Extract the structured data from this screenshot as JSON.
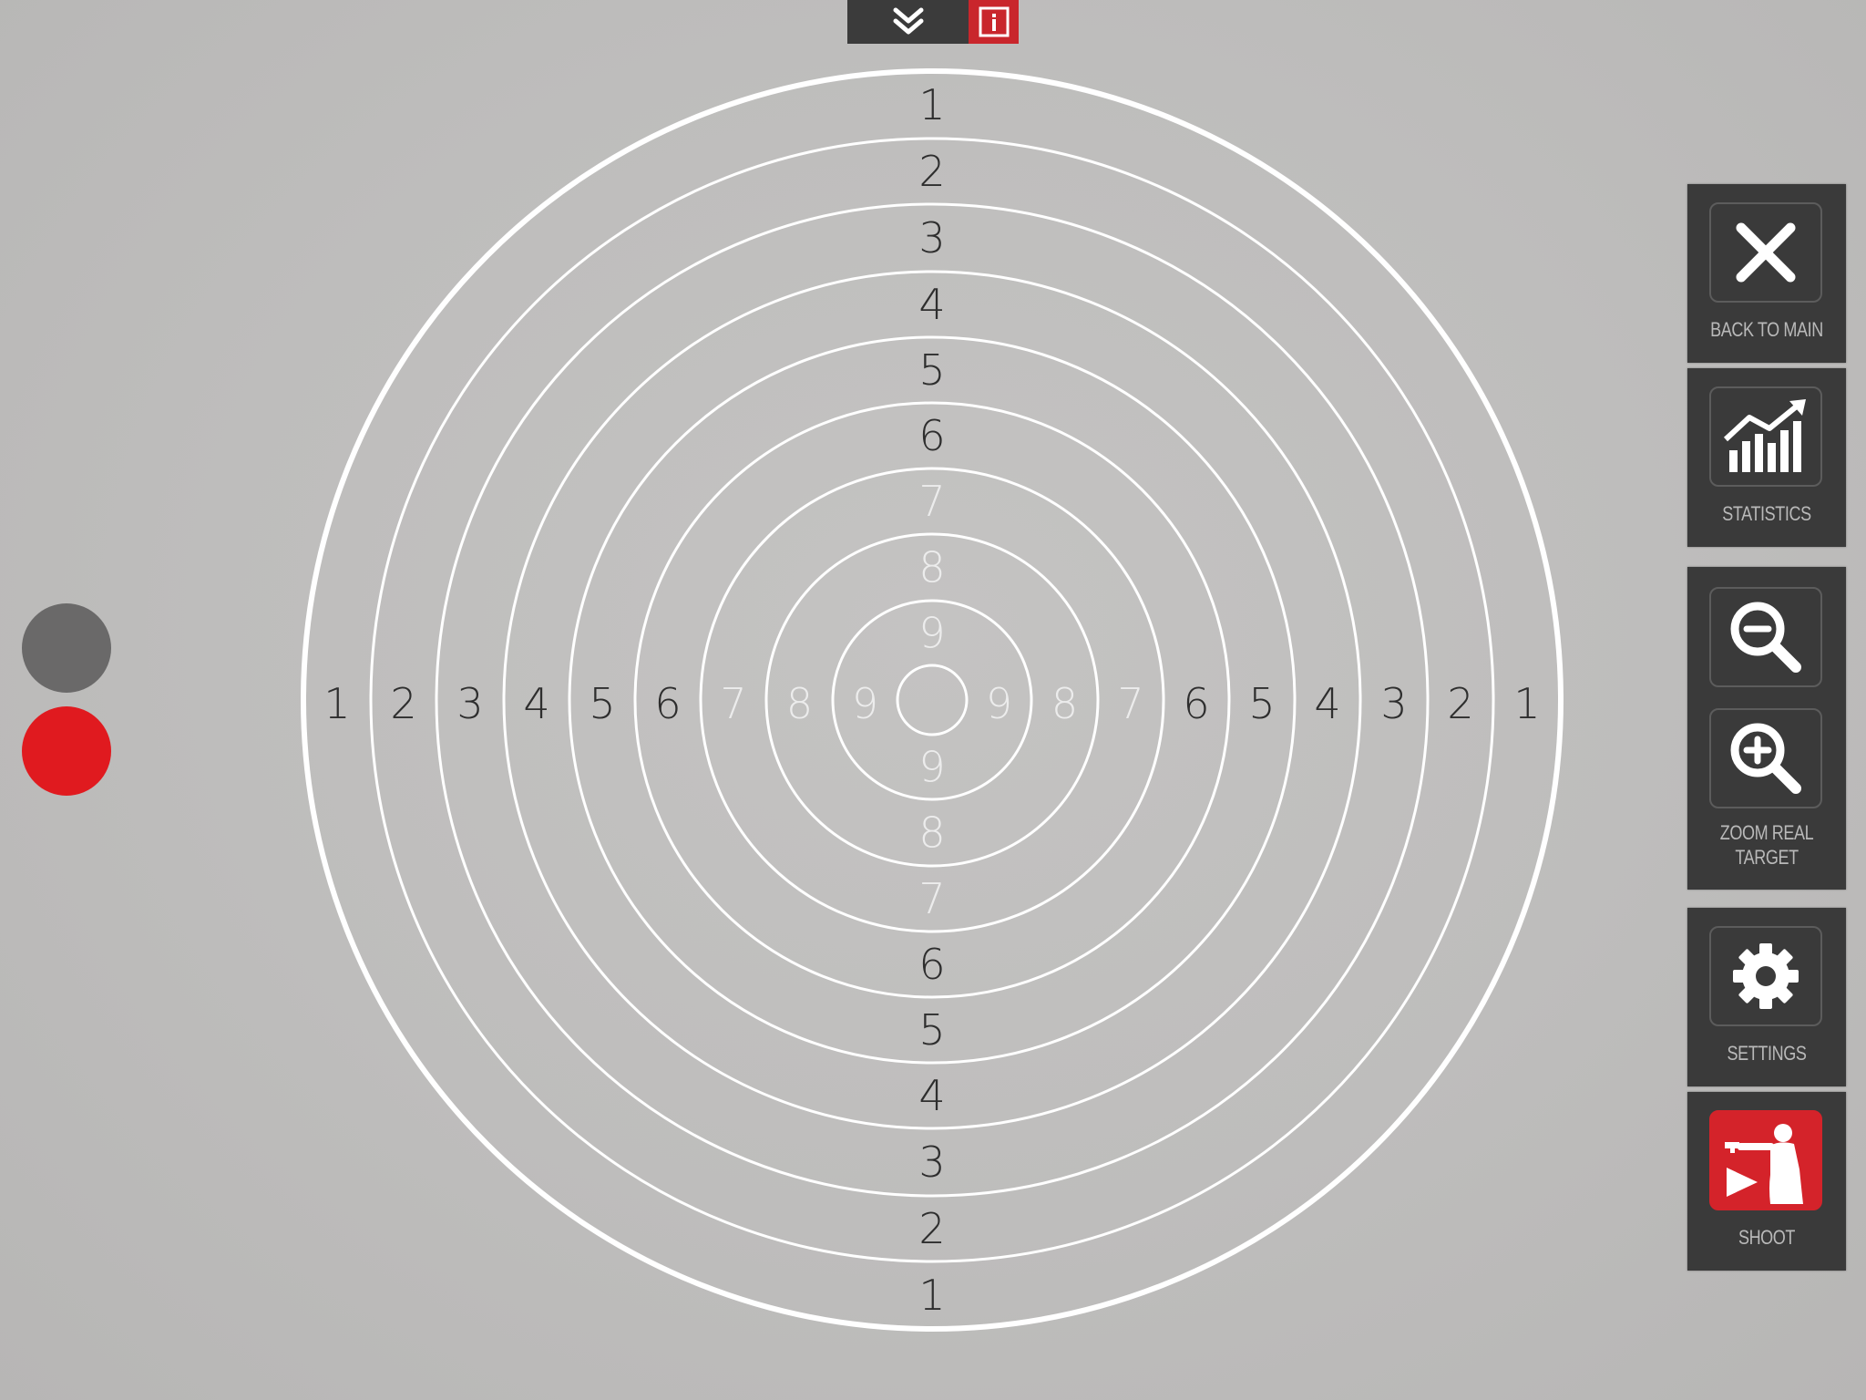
{
  "top_bar": {
    "collapse_icon": "double-chevron-down-icon",
    "info_icon": "info-icon",
    "info_color": "#c9262c"
  },
  "target": {
    "ring_numbers": [
      "1",
      "2",
      "3",
      "4",
      "5",
      "6",
      "7",
      "8",
      "9"
    ],
    "ring_color": "#ffffff"
  },
  "indicators": {
    "first_color": "#6a6969",
    "second_color": "#e01a1f"
  },
  "panel": {
    "back_to_main": {
      "label": "BACK TO MAIN",
      "icon": "close-icon"
    },
    "statistics": {
      "label": "STATISTICS",
      "icon": "chart-icon"
    },
    "zoom": {
      "label_line1": "ZOOM REAL",
      "label_line2": "TARGET",
      "zoom_out_icon": "zoom-out-icon",
      "zoom_in_icon": "zoom-in-icon"
    },
    "settings": {
      "label": "SETTINGS",
      "icon": "gear-icon"
    },
    "shoot": {
      "label": "SHOOT",
      "icon": "shooter-icon",
      "color": "#d4232a"
    }
  }
}
